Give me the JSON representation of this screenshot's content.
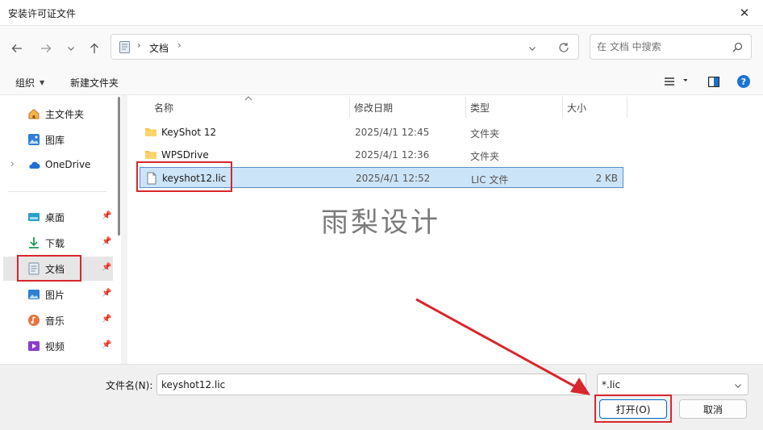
{
  "window": {
    "title": "安装许可证文件"
  },
  "address": {
    "crumb": "文档"
  },
  "search": {
    "placeholder": "在 文档 中搜索"
  },
  "toolbar": {
    "organize": "组织",
    "new_folder": "新建文件夹"
  },
  "sidebar": {
    "items": [
      {
        "label": "主文件夹",
        "icon": "home-icon"
      },
      {
        "label": "图库",
        "icon": "gallery-icon"
      },
      {
        "label": "OneDrive",
        "icon": "cloud-icon"
      },
      {
        "label": "桌面",
        "icon": "desktop-icon"
      },
      {
        "label": "下载",
        "icon": "download-icon"
      },
      {
        "label": "文档",
        "icon": "document-icon"
      },
      {
        "label": "图片",
        "icon": "picture-icon"
      },
      {
        "label": "音乐",
        "icon": "music-icon"
      },
      {
        "label": "视频",
        "icon": "video-icon"
      }
    ]
  },
  "columns": {
    "name": "名称",
    "date": "修改日期",
    "type": "类型",
    "size": "大小"
  },
  "files": [
    {
      "name": "KeyShot 12",
      "date": "2025/4/1 12:45",
      "type": "文件夹",
      "size": ""
    },
    {
      "name": "WPSDrive",
      "date": "2025/4/1 12:36",
      "type": "文件夹",
      "size": ""
    },
    {
      "name": "keyshot12.lic",
      "date": "2025/4/1 12:52",
      "type": "LIC 文件",
      "size": "2 KB"
    }
  ],
  "filename": {
    "label": "文件名(N):",
    "value": "keyshot12.lic"
  },
  "filter": {
    "value": "*.lic"
  },
  "buttons": {
    "open": "打开(O)",
    "cancel": "取消"
  },
  "watermark": "雨梨设计",
  "colors": {
    "accent": "#0067c0",
    "selection": "#cce4f7",
    "highlight": "#d9262c",
    "folder": "#f8c64a"
  }
}
